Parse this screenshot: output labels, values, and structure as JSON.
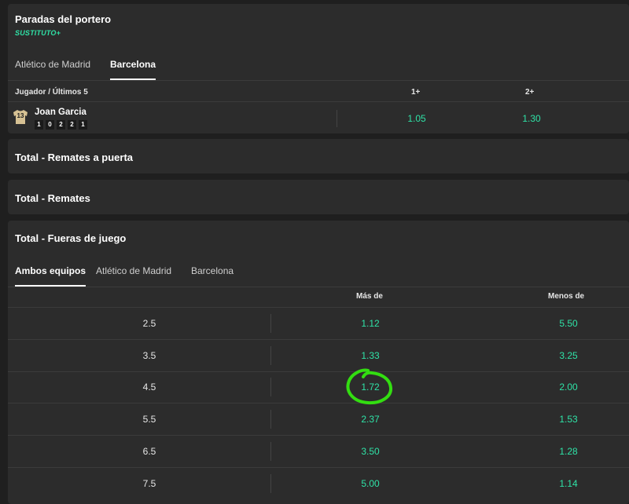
{
  "goalkeeper_saves": {
    "title": "Paradas del portero",
    "badge": "SUSTITUTO+",
    "tabs": [
      "Atlético de Madrid",
      "Barcelona"
    ],
    "active_tab": "Barcelona",
    "header": {
      "player_col": "Jugador / Últimos 5",
      "col1": "1+",
      "col2": "2+"
    },
    "player": {
      "shirt_number": "13",
      "name": "Joan Garcia",
      "last5": [
        "1",
        "0",
        "2",
        "2",
        "1"
      ],
      "odd1": "1.05",
      "odd2": "1.30"
    }
  },
  "shots_on_target": {
    "title": "Total - Remates a puerta"
  },
  "shots": {
    "title": "Total - Remates"
  },
  "offsides": {
    "title": "Total - Fueras de juego",
    "tabs": [
      "Ambos equipos",
      "Atlético de Madrid",
      "Barcelona"
    ],
    "active_tab": "Ambos equipos",
    "header": {
      "over": "Más de",
      "under": "Menos de"
    },
    "rows": [
      {
        "line": "2.5",
        "over": "1.12",
        "under": "5.50"
      },
      {
        "line": "3.5",
        "over": "1.33",
        "under": "3.25"
      },
      {
        "line": "4.5",
        "over": "1.72",
        "under": "2.00"
      },
      {
        "line": "5.5",
        "over": "2.37",
        "under": "1.53"
      },
      {
        "line": "6.5",
        "over": "3.50",
        "under": "1.28"
      },
      {
        "line": "7.5",
        "over": "5.00",
        "under": "1.14"
      }
    ]
  },
  "colors": {
    "accent_green": "#2fe3a7",
    "annotation_circle": "#33dd11",
    "card_bg": "#2c2c2c",
    "page_bg": "#1f1f1f"
  }
}
